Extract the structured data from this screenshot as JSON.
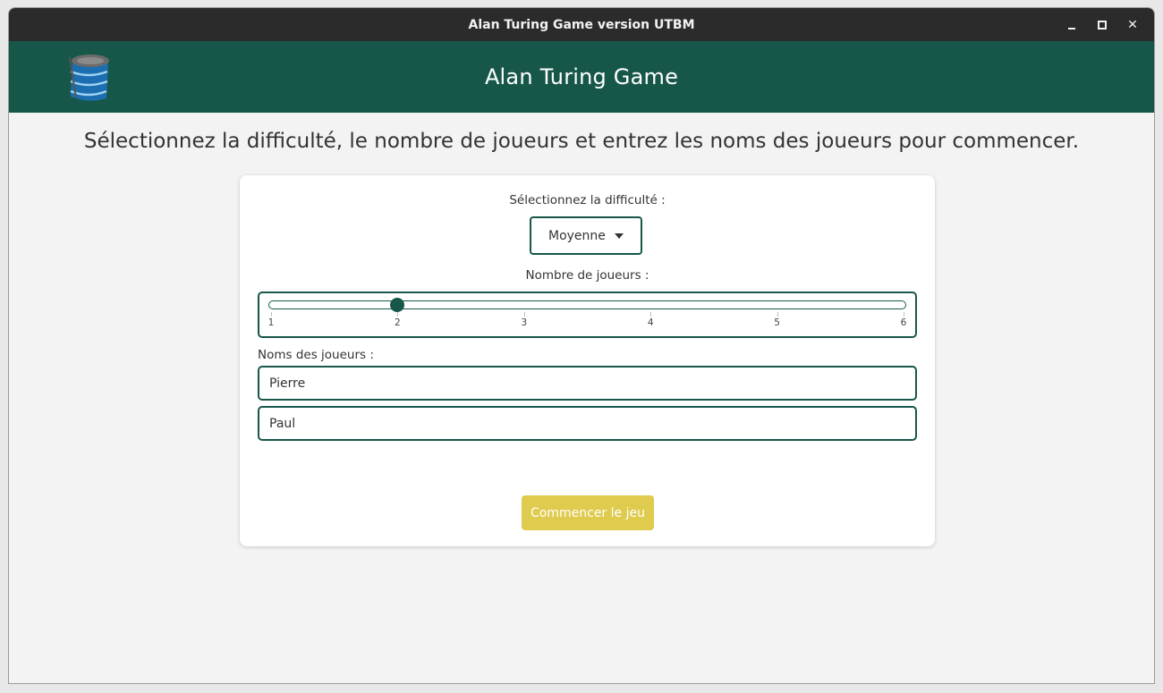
{
  "window": {
    "title": "Alan Turing Game version UTBM",
    "controls": {
      "minimize": "minimize-icon",
      "maximize": "maximize-icon",
      "close": "✕"
    }
  },
  "header": {
    "title": "Alan Turing Game",
    "logo_icon": "stacked-database-logo",
    "background_color": "#17574a"
  },
  "instruction": "Sélectionnez la difficulté, le nombre de joueurs et entrez les noms des joueurs pour commencer.",
  "form": {
    "difficulty_label": "Sélectionnez la difficulté :",
    "difficulty_value": "Moyenne",
    "player_count_label": "Nombre de joueurs :",
    "player_count": {
      "min": 1,
      "max": 6,
      "value": 2,
      "ticks": [
        "1",
        "2",
        "3",
        "4",
        "5",
        "6"
      ]
    },
    "names_label": "Noms des joueurs :",
    "player_names": [
      "Pierre",
      "Paul"
    ],
    "start_button": "Commencer le jeu"
  },
  "colors": {
    "accent": "#17574a",
    "button": "#dfcb4e",
    "titlebar": "#2b2b2b"
  }
}
